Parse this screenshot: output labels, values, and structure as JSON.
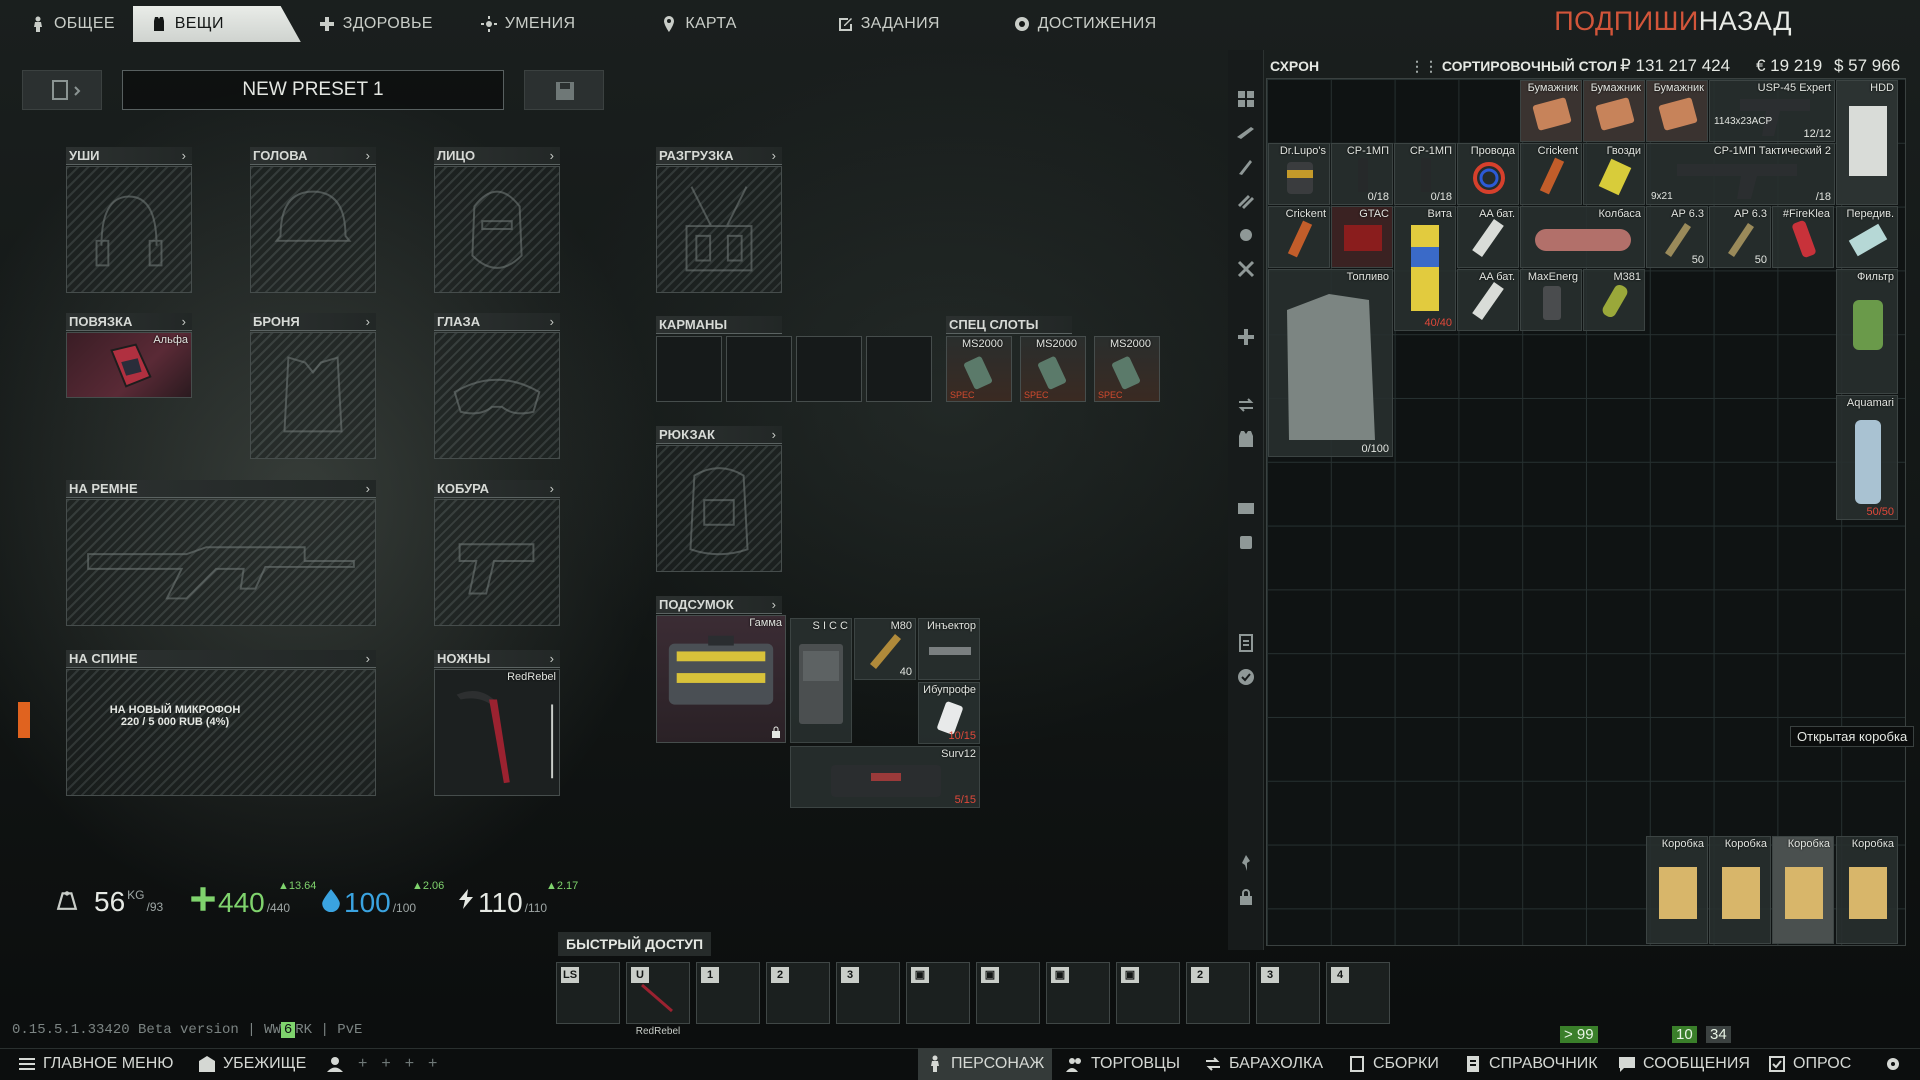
{
  "top_tabs": [
    {
      "label": "ОБЩЕЕ",
      "icon": "person-icon"
    },
    {
      "label": "ВЕЩИ",
      "icon": "vest-icon"
    },
    {
      "label": "ЗДОРОВЬЕ",
      "icon": "health-icon"
    },
    {
      "label": "УМЕНИЯ",
      "icon": "skills-icon"
    },
    {
      "label": "КАРТА",
      "icon": "map-pin-icon"
    },
    {
      "label": "ЗАДАНИЯ",
      "icon": "tasks-icon"
    },
    {
      "label": "ДОСТИЖЕНИЯ",
      "icon": "achievements-icon"
    }
  ],
  "header": {
    "overlay_text": "ПОДПИШИ",
    "back_label": "НАЗАД"
  },
  "preset": {
    "name": "NEW PRESET 1"
  },
  "slots": {
    "ears": "УШИ",
    "head": "ГОЛОВА",
    "face": "ЛИЦО",
    "armband": "ПОВЯЗКА",
    "armor": "БРОНЯ",
    "eyes": "ГЛАЗА",
    "belt_weapon": "НА РЕМНЕ",
    "holster": "КОБУРА",
    "back_weapon": "НА СПИНЕ",
    "knives": "НОЖНЫ",
    "rig": "РАЗГРУЗКА",
    "pockets": "КАРМАНЫ",
    "special": "СПЕЦ СЛОТЫ",
    "backpack": "РЮКЗАК",
    "pouch": "ПОДСУМОК"
  },
  "equipped": {
    "armband_item": "Альфа",
    "knife_item": "RedRebel",
    "special_items": [
      "MS2000",
      "MS2000",
      "MS2000"
    ],
    "special_tag": "SPEC",
    "pouch_item": "Гамма",
    "pouch_contents": [
      {
        "name": "S I C C"
      },
      {
        "name": "M80",
        "count": "40"
      },
      {
        "name": "Инъектор"
      },
      {
        "name": "Ибупрофе",
        "count": "10/15"
      },
      {
        "name": "Surv12",
        "count": "5/15"
      }
    ]
  },
  "notification": {
    "title": "НА НОВЫЙ МИКРОФОН",
    "progress_text": "220 / 5 000 RUB (4%)",
    "progress": 0.04
  },
  "stats": {
    "weight": "56",
    "weight_unit": "KG",
    "weight_max": "/93",
    "health": "440",
    "health_max": "/440",
    "health_delta": "▲13.64",
    "hydration": "100",
    "hydration_max": "/100",
    "hydration_delta": "▲2.06",
    "energy": "110",
    "energy_max": "/110",
    "energy_delta": "▲2.17"
  },
  "quick_access": {
    "title": "БЫСТРЫЙ ДОСТУП",
    "keys": [
      "LS",
      "U",
      "1",
      "2",
      "3",
      "",
      "",
      "",
      "",
      "2",
      "3",
      "4"
    ],
    "u_item": "RedRebel"
  },
  "stash": {
    "tab_stash": "СХРОН",
    "tab_sorting": "СОРТИРОВОЧНЫЙ СТОЛ",
    "rubles": "₽ 131 217 424",
    "euros": "€ 19 219",
    "dollars": "$ 57 966",
    "items": [
      {
        "name": "Бумажник"
      },
      {
        "name": "Бумажник"
      },
      {
        "name": "Бумажник"
      },
      {
        "name": "USP-45 Expert",
        "count": "12/12",
        "sub": "1143x23ACP"
      },
      {
        "name": "HDD"
      },
      {
        "name": "Dr.Lupo's"
      },
      {
        "name": "СР-1МП",
        "count": "0/18"
      },
      {
        "name": "СР-1МП",
        "count": "0/18"
      },
      {
        "name": "Провода"
      },
      {
        "name": "Crickent"
      },
      {
        "name": "Гвозди"
      },
      {
        "name": "СР-1МП Тактический 2",
        "count": "/18",
        "sub": "9x21"
      },
      {
        "name": "Crickent"
      },
      {
        "name": "GTAC"
      },
      {
        "name": "Вита",
        "count": "40/40"
      },
      {
        "name": "AA бат."
      },
      {
        "name": "Колбаса"
      },
      {
        "name": "AP 6.3",
        "count": "50"
      },
      {
        "name": "AP 6.3",
        "count": "50"
      },
      {
        "name": "#FireKlea"
      },
      {
        "name": "Передив."
      },
      {
        "name": "Фильтр"
      },
      {
        "name": "Топливо",
        "count": "0/100"
      },
      {
        "name": "AA бат."
      },
      {
        "name": "MaxEnerg"
      },
      {
        "name": "M381"
      },
      {
        "name": "Aquamari",
        "count": "50/50"
      },
      {
        "name": "Коробка"
      },
      {
        "name": "Коробка"
      },
      {
        "name": "Коробка"
      },
      {
        "name": "Коробка"
      }
    ],
    "tooltip": "Открытая коробка"
  },
  "version": "0.15.5.1.33420 Beta version | WW",
  "version_tail": "RK | PvE",
  "version_badge": "6",
  "bottom_nav": [
    "ГЛАВНОЕ МЕНЮ",
    "УБЕЖИЩЕ",
    "ПЕРСОНАЖ",
    "ТОРГОВЦЫ",
    "БАРАХОЛКА",
    "СБОРКИ",
    "СПРАВОЧНИК",
    "СООБЩЕНИЯ",
    "ОПРОС"
  ],
  "indicators": {
    "a": "> 99",
    "b": "10",
    "c": "34"
  },
  "colors": {
    "accent_green": "#7fd36d",
    "accent_red": "#d2553a",
    "panel": "#171b1b"
  }
}
